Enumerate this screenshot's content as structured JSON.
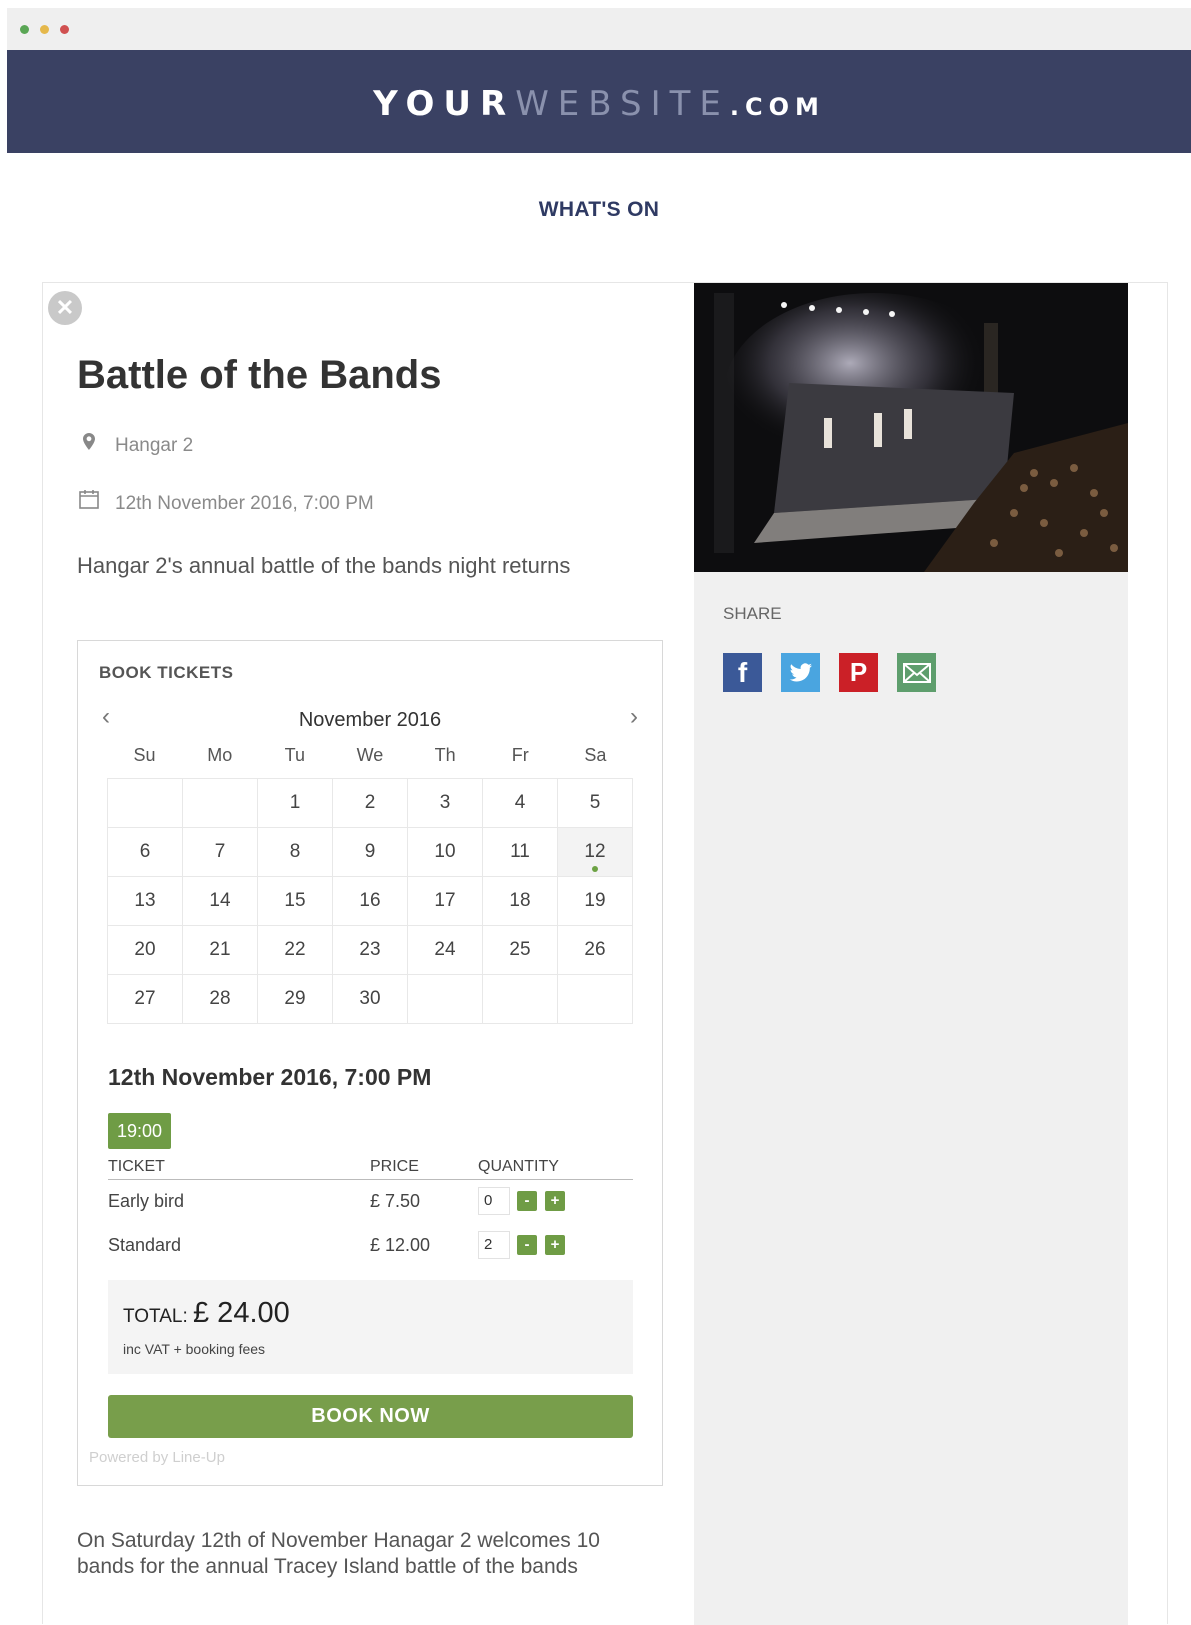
{
  "browser": {
    "dots": [
      "green",
      "yellow",
      "red"
    ]
  },
  "header": {
    "brand_part1": "YOUR",
    "brand_part2": "WEBSITE",
    "brand_part3": ".COM",
    "nav_title": "WHAT'S ON"
  },
  "event": {
    "close_icon": "close-icon",
    "title": "Battle of the Bands",
    "venue": "Hangar 2",
    "datetime": "12th November 2016, 7:00 PM",
    "tagline": "Hangar 2's annual battle of the bands night returns",
    "description": "On Saturday 12th of November Hanagar 2 welcomes 10 bands for the annual Tracey Island battle of the bands"
  },
  "booking": {
    "heading": "BOOK TICKETS",
    "month_label": "November 2016",
    "weekdays": [
      "Su",
      "Mo",
      "Tu",
      "We",
      "Th",
      "Fr",
      "Sa"
    ],
    "weeks": [
      [
        "",
        "",
        "1",
        "2",
        "3",
        "4",
        "5"
      ],
      [
        "6",
        "7",
        "8",
        "9",
        "10",
        "11",
        "12"
      ],
      [
        "13",
        "14",
        "15",
        "16",
        "17",
        "18",
        "19"
      ],
      [
        "20",
        "21",
        "22",
        "23",
        "24",
        "25",
        "26"
      ],
      [
        "27",
        "28",
        "29",
        "30",
        "",
        "",
        ""
      ]
    ],
    "selected_day": "12",
    "selected_datetime": "12th November 2016, 7:00 PM",
    "time_slot": "19:00",
    "columns": {
      "ticket": "TICKET",
      "price": "PRICE",
      "quantity": "QUANTITY"
    },
    "tickets": [
      {
        "name": "Early bird",
        "price": "£ 7.50",
        "quantity": "0"
      },
      {
        "name": "Standard",
        "price": "£ 12.00",
        "quantity": "2"
      }
    ],
    "minus_label": "-",
    "plus_label": "+",
    "total_label": "TOTAL:",
    "total_amount": "£ 24.00",
    "total_note": "inc VAT + booking fees",
    "book_button": "BOOK NOW",
    "powered_by": "Powered by Line-Up"
  },
  "sidebar": {
    "share_label": "SHARE",
    "social": [
      "facebook-icon",
      "twitter-icon",
      "pinterest-icon",
      "email-icon"
    ]
  },
  "colors": {
    "banner": "#3a4163",
    "accent_green": "#789e4b",
    "nav": "#2f3a63"
  }
}
